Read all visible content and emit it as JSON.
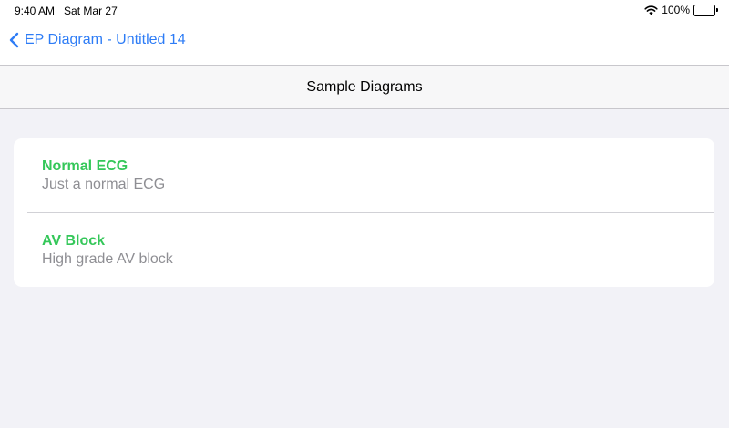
{
  "status_bar": {
    "time": "9:40 AM",
    "date": "Sat Mar 27",
    "battery": "100%",
    "wifi_icon": "wifi-icon",
    "battery_icon": "battery-full-icon"
  },
  "nav": {
    "back_label": "EP Diagram - Untitled 14",
    "back_icon": "chevron-left-icon"
  },
  "header": {
    "title": "Sample Diagrams"
  },
  "list": {
    "items": [
      {
        "title": "Normal ECG",
        "subtitle": "Just a normal ECG"
      },
      {
        "title": "AV Block",
        "subtitle": "High grade AV block"
      }
    ]
  },
  "colors": {
    "accent_blue": "#2d7cf6",
    "item_title_green": "#34c759",
    "subtitle_gray": "#8e8e93",
    "background": "#f2f2f7"
  }
}
